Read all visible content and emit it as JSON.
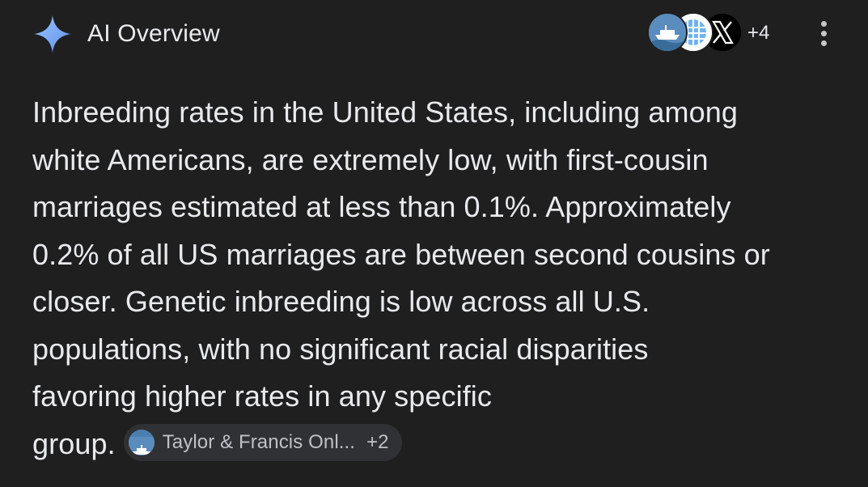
{
  "header": {
    "title": "AI Overview",
    "sparkle_icon": "gemini-sparkle-icon",
    "sparkle_color": "#8ab4f8",
    "source_avatars": [
      {
        "icon": "taylor-francis-ship-icon"
      },
      {
        "icon": "globe-grid-icon"
      },
      {
        "icon": "x-logo-icon"
      }
    ],
    "more_sources_count": "+4",
    "menu_icon": "more-vert-icon"
  },
  "overview": {
    "lines": [
      "Inbreeding rates in the United States, including among",
      "white Americans, are extremely low, with first-cousin",
      "marriages estimated at less than 0.1%. Approximately",
      "0.2% of all US marriages are between second cousins or",
      "closer. Genetic inbreeding is low across all U.S.",
      "populations, with no significant racial disparities",
      "favoring higher rates in any specific",
      "group."
    ],
    "citation": {
      "label": "Taylor & Francis Onl...",
      "more": "+2",
      "icon": "taylor-francis-ship-icon"
    }
  },
  "colors": {
    "background": "#1f1f1f",
    "text": "#e8eaed",
    "chip_background": "#303134",
    "chip_text": "#bdc1c6"
  }
}
